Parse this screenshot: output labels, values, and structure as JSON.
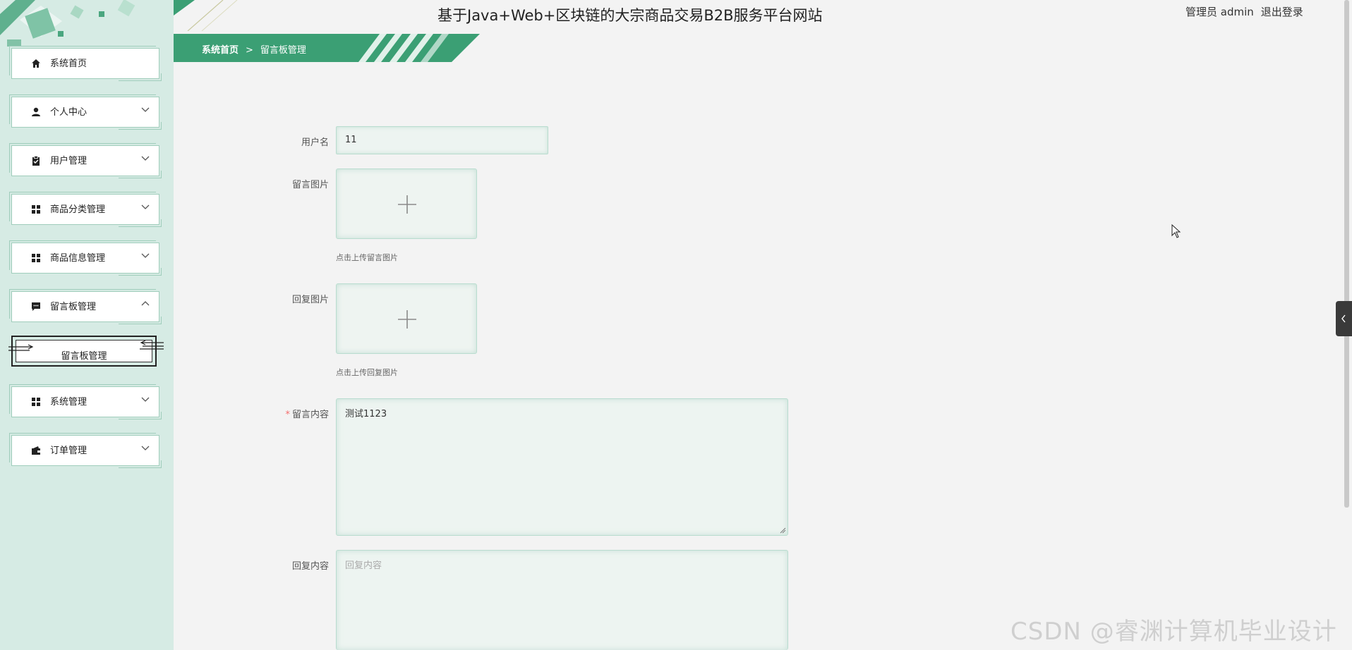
{
  "header": {
    "title": "基于Java+Web+区块链的大宗商品交易B2B服务平台网站",
    "user": "管理员 admin",
    "logout": "退出登录"
  },
  "breadcrumb": {
    "home": "系统首页",
    "separator": ">",
    "current": "留言板管理"
  },
  "sidebar": {
    "items": [
      {
        "label": "系统首页",
        "icon": "home-icon"
      },
      {
        "label": "个人中心",
        "icon": "person-icon"
      },
      {
        "label": "用户管理",
        "icon": "clipboard-icon"
      },
      {
        "label": "商品分类管理",
        "icon": "grid-icon"
      },
      {
        "label": "商品信息管理",
        "icon": "grid-icon"
      },
      {
        "label": "留言板管理",
        "icon": "chat-icon"
      },
      {
        "label": "系统管理",
        "icon": "grid-icon"
      },
      {
        "label": "订单管理",
        "icon": "wallet-icon"
      }
    ],
    "sub_item": "留言板管理"
  },
  "form": {
    "username_label": "用户名",
    "username_value": "11",
    "msg_image_label": "留言图片",
    "msg_image_hint": "点击上传留言图片",
    "reply_image_label": "回复图片",
    "reply_image_hint": "点击上传回复图片",
    "content_required": "*",
    "content_label": "留言内容",
    "content_value": "测试1123",
    "reply_label": "回复内容",
    "reply_placeholder": "回复内容"
  },
  "watermark": "CSDN @睿渊计算机毕业设计",
  "colors": {
    "accent": "#3b9f74",
    "sidebar_bg": "#d6ebe4",
    "page_bg": "#f3f3f3",
    "required": "#f56c6c"
  }
}
